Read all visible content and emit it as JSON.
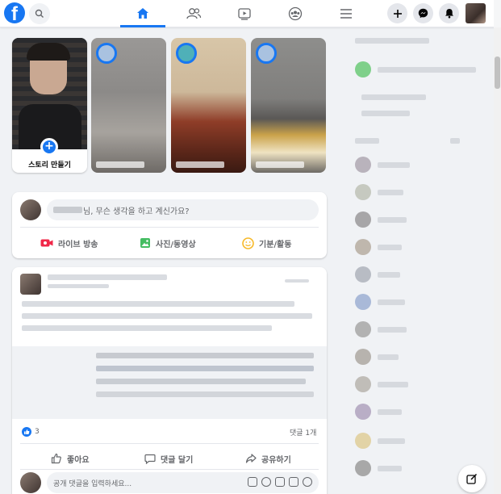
{
  "header": {
    "logo_letter": "f",
    "nav_tabs": [
      {
        "name": "home",
        "icon": "home-icon",
        "active": true
      },
      {
        "name": "friends",
        "icon": "friends-icon",
        "active": false
      },
      {
        "name": "watch",
        "icon": "watch-icon",
        "active": false
      },
      {
        "name": "groups",
        "icon": "groups-icon",
        "active": false
      },
      {
        "name": "menu",
        "icon": "menu-icon",
        "active": false
      }
    ],
    "right_buttons": [
      "create-icon",
      "messenger-icon",
      "notifications-icon"
    ]
  },
  "stories": {
    "create_label": "스토리 만들기",
    "plus": "+"
  },
  "composer": {
    "placeholder_suffix": "님, 무슨 생각을 하고 계신가요?",
    "actions": [
      {
        "label": "라이브 방송",
        "icon": "live-video-icon",
        "color": "#f02849"
      },
      {
        "label": "사진/동영상",
        "icon": "photo-video-icon",
        "color": "#45bd62"
      },
      {
        "label": "기분/활동",
        "icon": "feeling-icon",
        "color": "#f7b928"
      }
    ]
  },
  "post": {
    "reaction_count": "3",
    "comment_count": "댓글 1개",
    "actions": {
      "like": "좋아요",
      "comment": "댓글 달기",
      "share": "공유하기"
    },
    "comment_placeholder": "공개 댓글을 입력하세요..."
  },
  "colors": {
    "brand": "#1877f2",
    "background": "#f0f2f5"
  }
}
